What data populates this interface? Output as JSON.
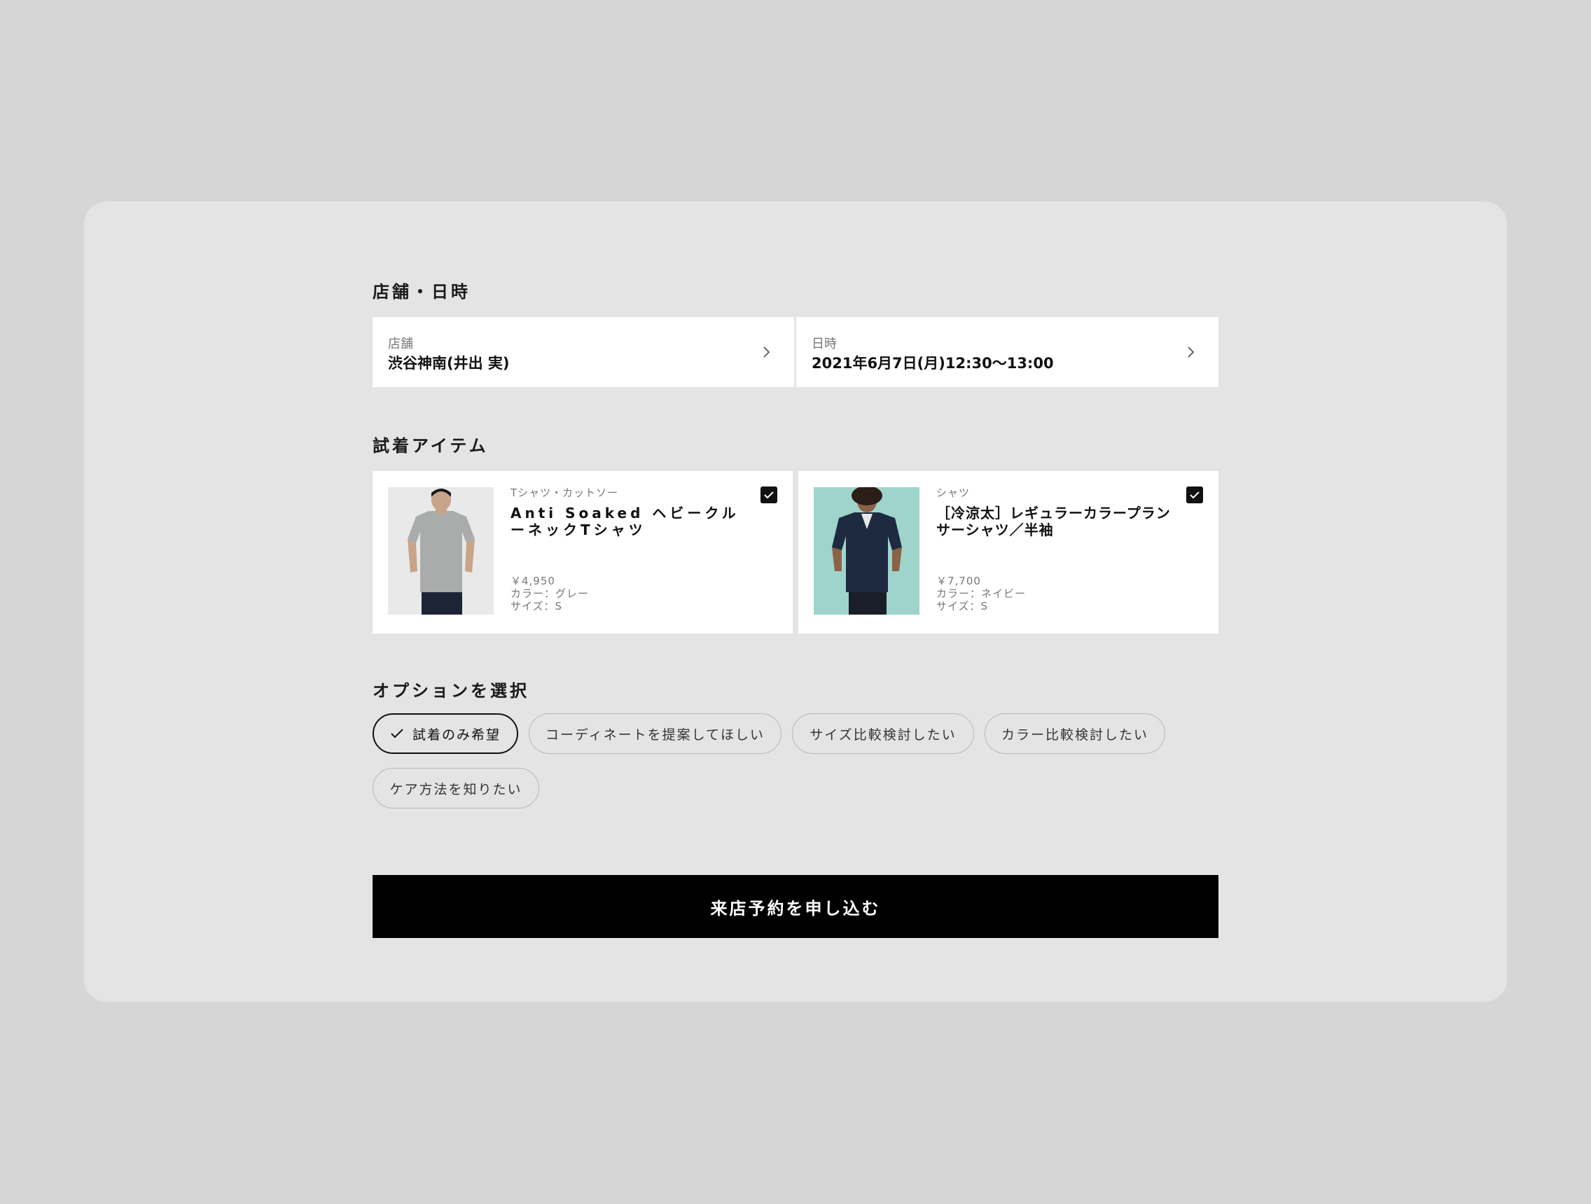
{
  "store_datetime": {
    "section_title": "店舗・日時",
    "store_label": "店舗",
    "store_value": "渋谷神南(井出 実)",
    "datetime_label": "日時",
    "datetime_value": "2021年6月7日(月)12:30〜13:00"
  },
  "items": {
    "section_title": "試着アイテム",
    "list": [
      {
        "category": "Tシャツ・カットソー",
        "name": "Anti Soaked ヘビークルーネックTシャツ",
        "price": "￥4,950",
        "color": "カラー：グレー",
        "size": "サイズ：S",
        "checked": true,
        "photo_bg": "#e9e9e9",
        "shirt_color": "#a9acaa"
      },
      {
        "category": "シャツ",
        "name": "［冷涼太］レギュラーカラープランサーシャツ／半袖",
        "price": "￥7,700",
        "color": "カラー：ネイビー",
        "size": "サイズ：S",
        "checked": true,
        "photo_bg": "#9fd4cc",
        "shirt_color": "#1e2a40"
      }
    ]
  },
  "options": {
    "section_title": "オプションを選択",
    "chips": [
      {
        "label": "試着のみ希望",
        "selected": true
      },
      {
        "label": "コーディネートを提案してほしい",
        "selected": false
      },
      {
        "label": "サイズ比較検討したい",
        "selected": false
      },
      {
        "label": "カラー比較検討したい",
        "selected": false
      },
      {
        "label": "ケア方法を知りたい",
        "selected": false
      }
    ]
  },
  "submit_label": "来店予約を申し込む",
  "colors": {
    "page_bg": "#d6d6d6",
    "card_bg": "#e4e4e4",
    "accent": "#000000"
  }
}
